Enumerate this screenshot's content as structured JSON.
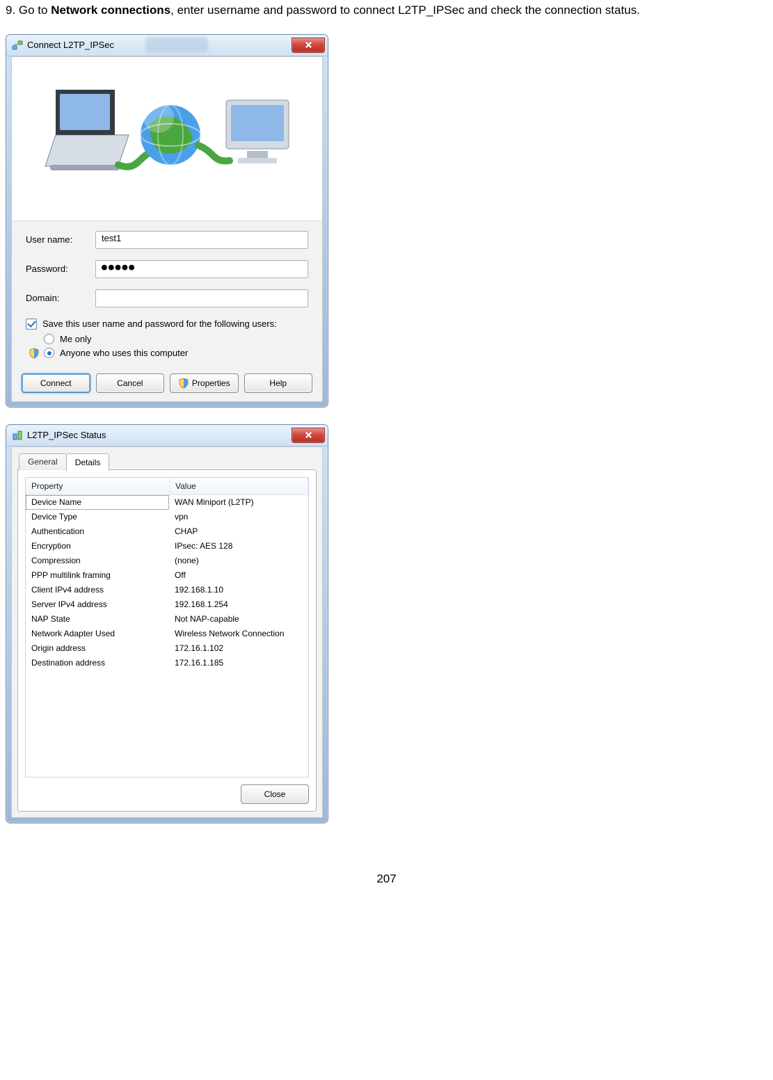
{
  "instruction": {
    "prefix": "9. Go to ",
    "bold": "Network connections",
    "suffix": ", enter username and password to connect L2TP_IPSec and check the connection status."
  },
  "connect": {
    "title": "Connect L2TP_IPSec",
    "labels": {
      "username": "User name:",
      "password": "Password:",
      "domain": "Domain:"
    },
    "values": {
      "username": "test1",
      "password": "●●●●●",
      "domain": ""
    },
    "save_line": "Save this user name and password for the following users:",
    "radio_me": "Me only",
    "radio_any": "Anyone who uses this computer",
    "buttons": {
      "connect": "Connect",
      "cancel": "Cancel",
      "properties": "Properties",
      "help": "Help"
    }
  },
  "status": {
    "title": "L2TP_IPSec Status",
    "tabs": {
      "general": "General",
      "details": "Details"
    },
    "columns": {
      "property": "Property",
      "value": "Value"
    },
    "rows": [
      {
        "p": "Device Name",
        "v": "WAN Miniport (L2TP)"
      },
      {
        "p": "Device Type",
        "v": "vpn"
      },
      {
        "p": "Authentication",
        "v": "CHAP"
      },
      {
        "p": "Encryption",
        "v": "IPsec: AES 128"
      },
      {
        "p": "Compression",
        "v": "(none)"
      },
      {
        "p": "PPP multilink framing",
        "v": "Off"
      },
      {
        "p": "Client IPv4 address",
        "v": "192.168.1.10"
      },
      {
        "p": "Server IPv4 address",
        "v": "192.168.1.254"
      },
      {
        "p": "NAP State",
        "v": "Not NAP-capable"
      },
      {
        "p": "Network Adapter Used",
        "v": "Wireless Network Connection"
      },
      {
        "p": "Origin address",
        "v": "172.16.1.102"
      },
      {
        "p": "Destination address",
        "v": "172.16.1.185"
      }
    ],
    "close": "Close"
  },
  "page_number": "207"
}
